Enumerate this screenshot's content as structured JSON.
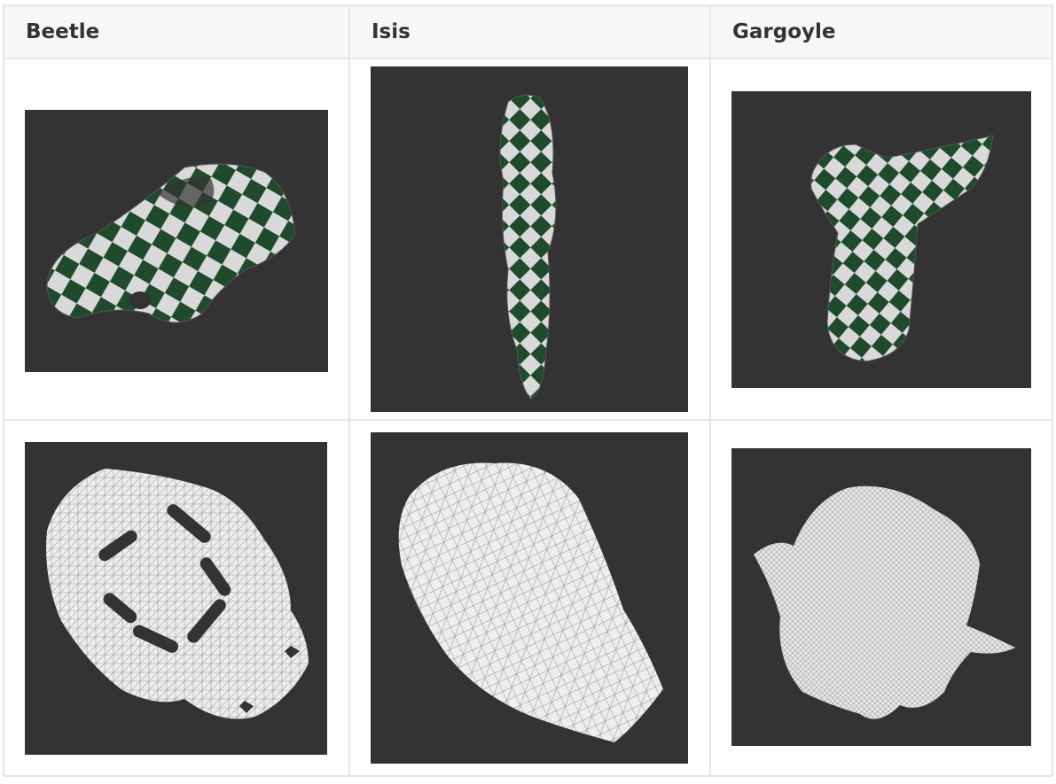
{
  "table": {
    "headers": [
      "Beetle",
      "Isis",
      "Gargoyle"
    ],
    "rows": [
      [
        "beetle-textured-render",
        "isis-textured-render",
        "gargoyle-textured-render"
      ],
      [
        "beetle-uv-parameterization",
        "isis-uv-parameterization",
        "gargoyle-uv-parameterization"
      ]
    ]
  },
  "colors": {
    "render_bg": "#333333",
    "checker_dark": "#1f4a2b",
    "checker_light": "#d9d9d9",
    "header_bg": "#f7f7f7",
    "border": "#e6e6e6",
    "mesh_fill": "#eeeeee",
    "mesh_line": "#9a9a9a"
  }
}
